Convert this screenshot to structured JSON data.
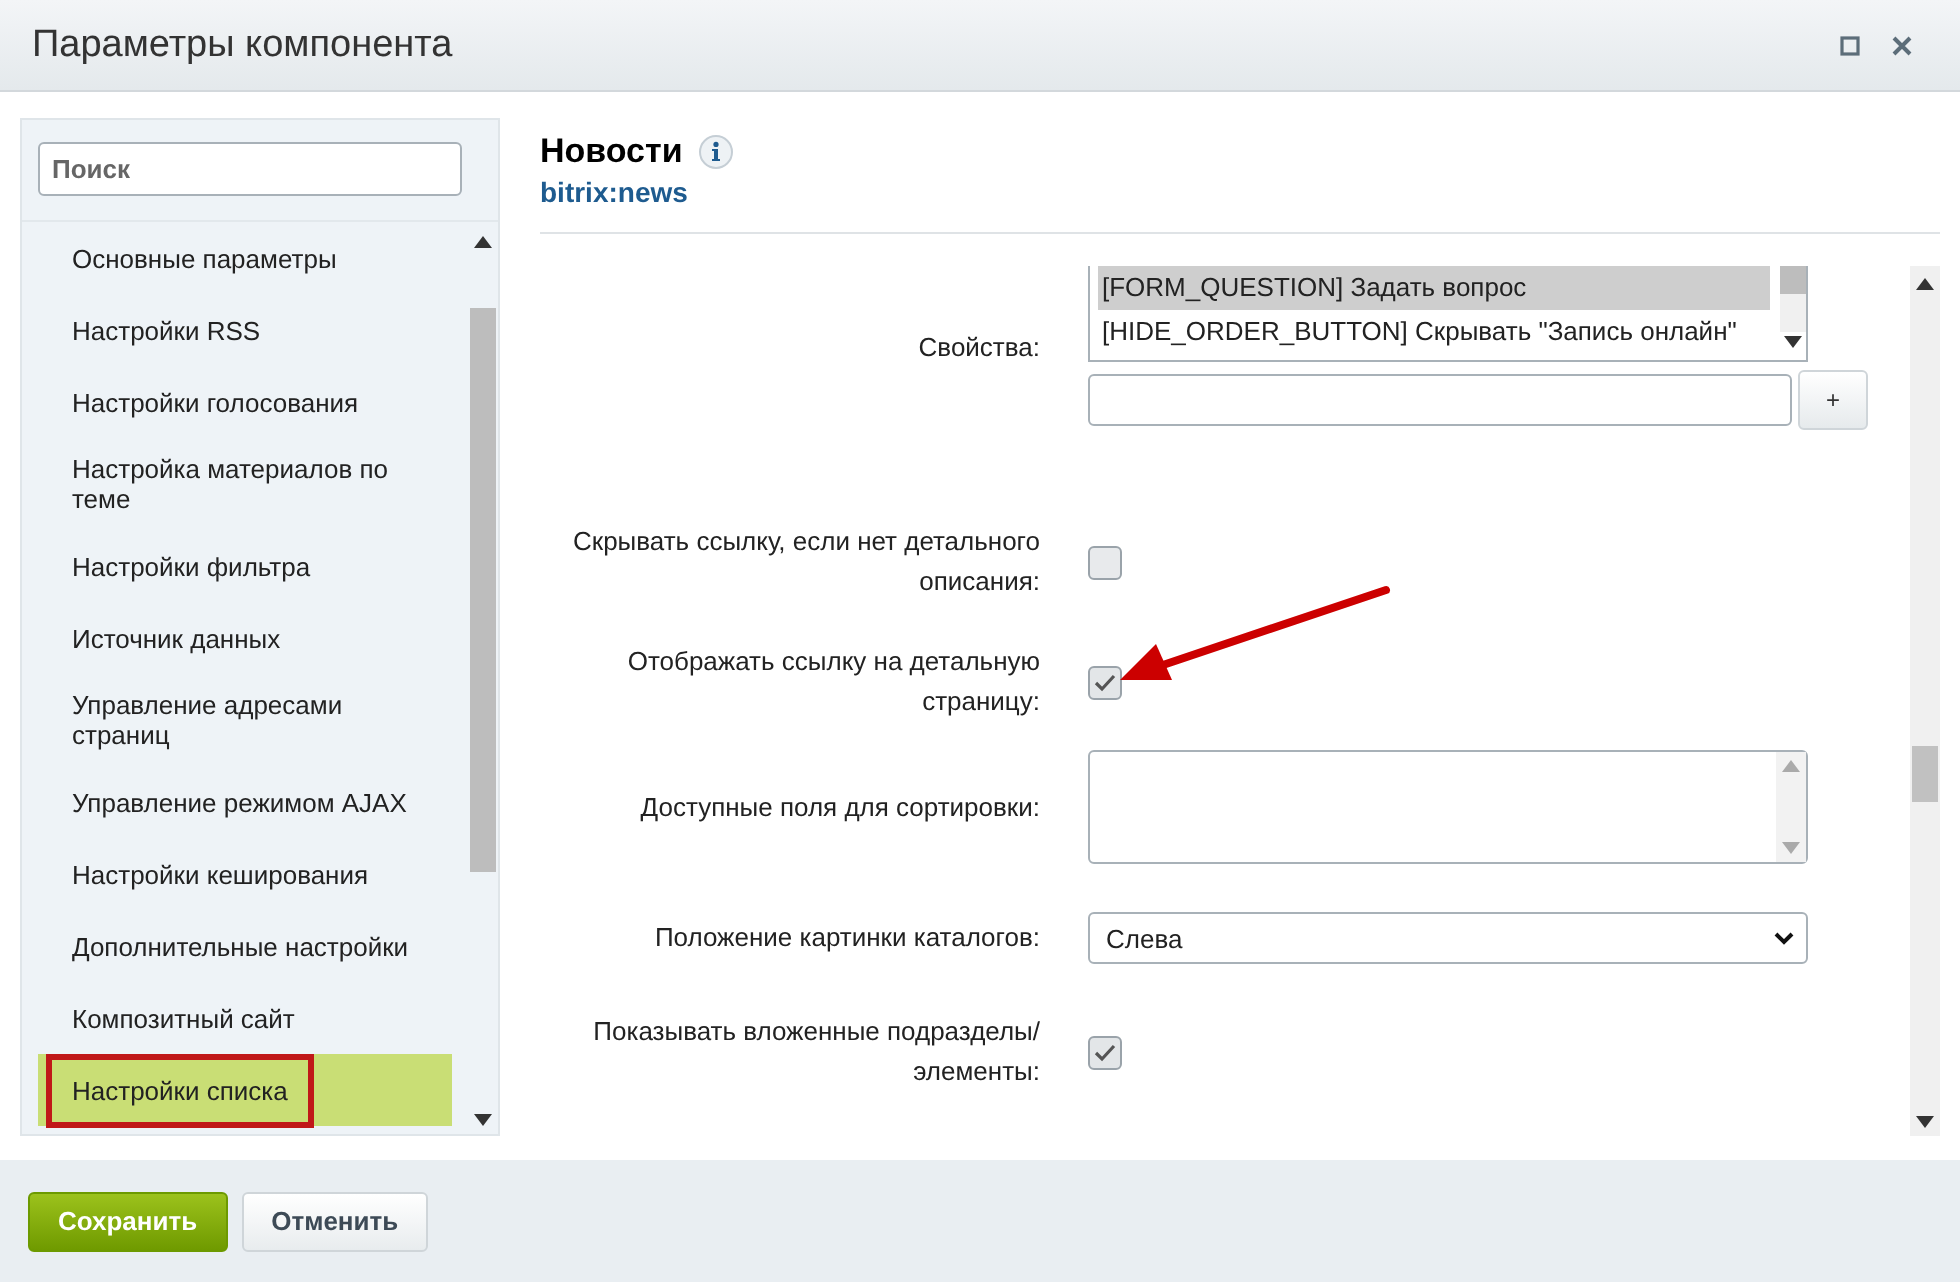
{
  "window": {
    "title": "Параметры компонента"
  },
  "sidebar": {
    "search": {
      "placeholder": "Поиск"
    },
    "items": [
      {
        "label": "Основные параметры",
        "selected": false,
        "highlighted": false
      },
      {
        "label": "Настройки RSS",
        "selected": false,
        "highlighted": false
      },
      {
        "label": "Настройки голосования",
        "selected": false,
        "highlighted": false
      },
      {
        "label": "Настройка материалов по теме",
        "selected": false,
        "highlighted": false
      },
      {
        "label": "Настройки фильтра",
        "selected": false,
        "highlighted": false
      },
      {
        "label": "Источник данных",
        "selected": false,
        "highlighted": false
      },
      {
        "label": "Управление адресами страниц",
        "selected": false,
        "highlighted": false
      },
      {
        "label": "Управление режимом AJAX",
        "selected": false,
        "highlighted": false
      },
      {
        "label": "Настройки кеширования",
        "selected": false,
        "highlighted": false
      },
      {
        "label": "Дополнительные настройки",
        "selected": false,
        "highlighted": false
      },
      {
        "label": "Композитный сайт",
        "selected": false,
        "highlighted": false
      },
      {
        "label": "Настройки списка",
        "selected": true,
        "highlighted": true
      }
    ]
  },
  "component": {
    "title": "Новости",
    "code": "bitrix:news"
  },
  "fields": [
    {
      "kind": "multiselect",
      "label": "Свойства:",
      "options": [
        {
          "text": "[FORM_QUESTION] Задать вопрос",
          "selected": true
        },
        {
          "text": "[HIDE_ORDER_BUTTON] Скрывать \"Запись онлайн\"",
          "selected": false
        }
      ],
      "add_button": "+"
    },
    {
      "kind": "checkbox",
      "label": "Скрывать ссылку, если нет детального описания:",
      "checked": false
    },
    {
      "kind": "checkbox",
      "label": "Отображать ссылку на детальную страницу:",
      "checked": true
    },
    {
      "kind": "listbox",
      "label": "Доступные поля для сортировки:"
    },
    {
      "kind": "select",
      "label": "Положение картинки каталогов:",
      "value": "Слева"
    },
    {
      "kind": "checkbox",
      "label": "Показывать вложенные подразделы/элементы:",
      "checked": true
    }
  ],
  "buttons": [
    {
      "label": "Сохранить",
      "kind": "primary"
    },
    {
      "label": "Отменить",
      "kind": "secondary"
    }
  ]
}
